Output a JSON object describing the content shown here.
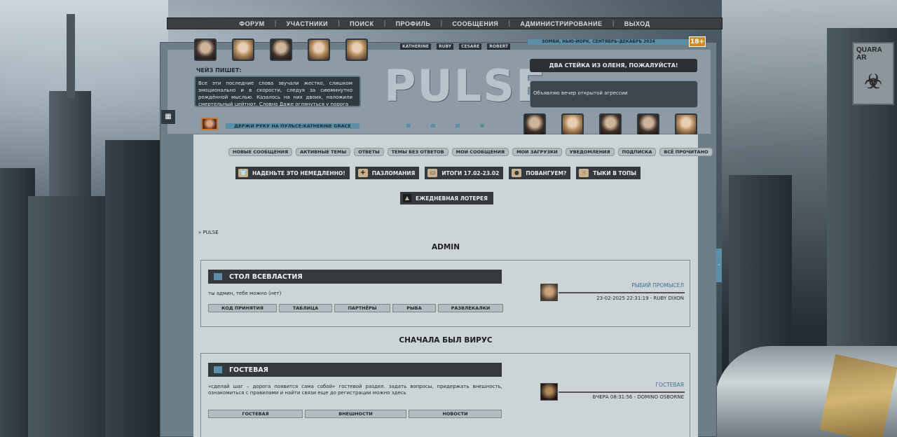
{
  "nav": {
    "items": [
      "ФОРУМ",
      "УЧАСТНИКИ",
      "ПОИСК",
      "ПРОФИЛЬ",
      "СООБЩЕНИЯ",
      "АДМИНИСТРИРОВАНИЕ",
      "ВЫХОД"
    ],
    "separator": "|"
  },
  "header": {
    "characters": [
      "KATHERINE",
      "RUBY",
      "CESARE",
      "ROBERT"
    ],
    "setting": "ЗОМБИ, НЬЮ-ЙОРК, СЕНТЯБРЬ-ДЕКАБРЬ 2024",
    "age_rating": "18+",
    "who_writes_label": "ЧЕЙЗ ПИШЕТ:",
    "who_writes_text": "Все эти последние слова звучали жестко, слишком эмоционально и в скорости, следуя за сиюминутно рождённой мыслью. Казалось на них двоих, наложили смертельный цейтнот. Словно Даже оглянуться у порога",
    "logo": "PULSE",
    "banner_title": "ДВА СТЕЙКА ИЗ ОЛЕНЯ, ПОЖАЛУЙСТА!",
    "banner_text": "Объявляю вечер открытой агрессии",
    "hold_bar": "ДЕРЖИ РУКУ НА ПУЛЬСЕ:KATHERINE GRACE"
  },
  "pills": [
    "НОВЫЕ СООБЩЕНИЯ",
    "АКТИВНЫЕ ТЕМЫ",
    "ОТВЕТЫ",
    "ТЕМЫ БЕЗ ОТВЕТОВ",
    "МОИ СООБЩЕНИЯ",
    "МОИ ЗАГРУЗКИ",
    "УВЕДОМЛЕНИЯ",
    "ПОДПИСКА",
    "ВСЁ ПРОЧИТАНО"
  ],
  "big_buttons": [
    {
      "label": "НАДЕНЬТЕ ЭТО НЕМЕДЛЕННО!",
      "icon": "shirt-icon"
    },
    {
      "label": "ПАЗЛОМАНИЯ",
      "icon": "puzzle-icon"
    },
    {
      "label": "ИТОГИ 17.02-23.02",
      "icon": "ticket-icon"
    },
    {
      "label": "ПОВАНГУЕМ?",
      "icon": "fortune-icon"
    },
    {
      "label": "ТЫКИ В ТОПЫ",
      "icon": "pointer-icon"
    }
  ],
  "lottery": "ЕЖЕДНЕВНАЯ ЛОТЕРЕЯ",
  "breadcrumb": "» PULSE",
  "categories": [
    {
      "title": "ADMIN",
      "forum": {
        "name": "СТОЛ ВСЕВЛАСТИЯ",
        "desc": "ты админ, тебе можно (нет)",
        "links": [
          "КОД ПРИНЯТИЯ",
          "ТАБЛИЦА",
          "ПАРТНЁРЫ",
          "РЫБА",
          "РАЗВЛЕКАЛКИ"
        ],
        "last_title": "РЫБИЙ ПРОМЫСЕЛ",
        "last_meta": "23-02-2025 22:31:19 - RUBY DIXON"
      }
    },
    {
      "title": "СНАЧАЛА БЫЛ ВИРУС",
      "forum": {
        "name": "ГОСТЕВАЯ",
        "desc": "«сделай шаг – дорога появится сама собой» гостевой раздел. задать вопросы, придержать внешность, ознакомиться с правилами и найти связи еще до регистрации можно здесь",
        "links": [
          "ГОСТЕВАЯ",
          "ВНЕШНОСТИ",
          "НОВОСТИ"
        ],
        "last_title": "ГОСТЕВАЯ",
        "last_meta": "ВЧЕРА 08:31:56 - DOMINO OSBORNE"
      }
    }
  ],
  "background": {
    "sign_text": "QUARA AR"
  }
}
